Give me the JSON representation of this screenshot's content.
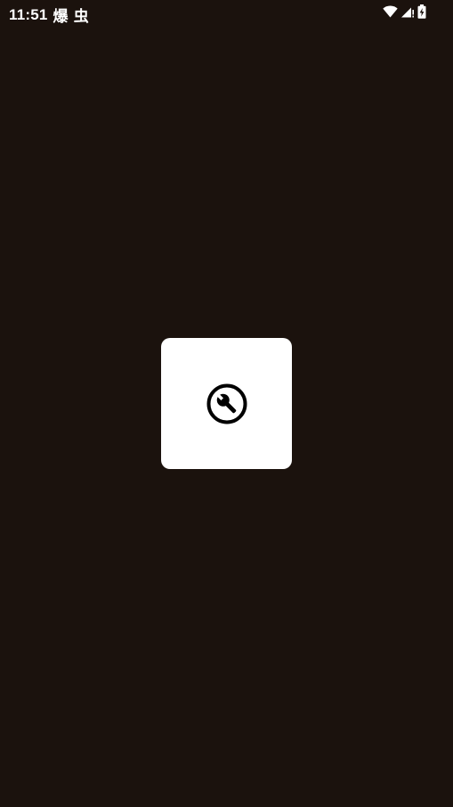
{
  "status_bar": {
    "time": "11:51",
    "notification_1": "爆",
    "notification_2": "虫",
    "icons": [
      "wifi-icon",
      "cell-signal-icon",
      "battery-charging-icon"
    ]
  },
  "center_card": {
    "icon": "wrench-circle-icon",
    "card_color": "#ffffff",
    "background_color": "#1b120d"
  }
}
